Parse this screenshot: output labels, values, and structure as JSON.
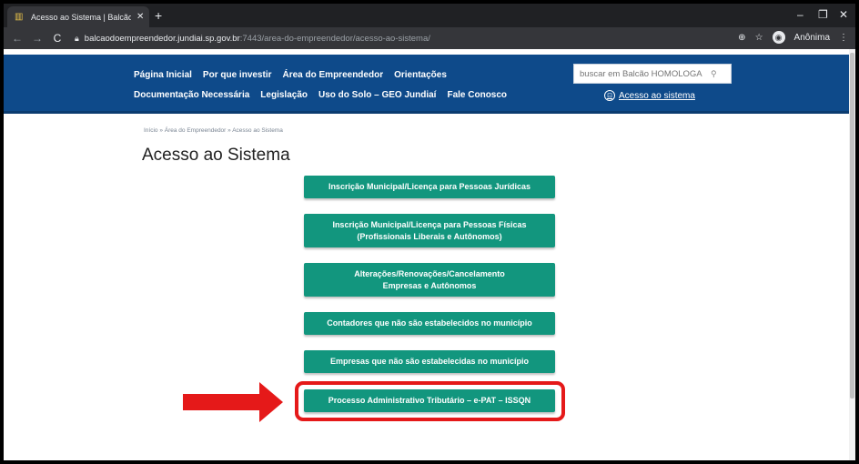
{
  "browser": {
    "tab_title": "Acesso ao Sistema | Balcão HOM",
    "tab_close": "✕",
    "new_tab": "+",
    "url_main": "balcaodoempreendedor.jundiai.sp.gov.br",
    "url_rest": ":7443/area-do-empreendedor/acesso-ao-sistema/",
    "profile_label": "Anônima",
    "icons": [
      "back-icon",
      "forward-icon",
      "reload-icon",
      "lock-icon",
      "zoom-icon",
      "star-icon",
      "incognito-icon",
      "menu-icon",
      "minimize-icon",
      "maximize-icon",
      "close-icon"
    ]
  },
  "header": {
    "nav_row1": [
      "Página Inicial",
      "Por que investir",
      "Área do Empreendedor",
      "Orientações"
    ],
    "nav_row2": [
      "Documentação Necessária",
      "Legislação",
      "Uso do Solo – GEO Jundiaí",
      "Fale Conosco"
    ],
    "search_placeholder": "buscar em Balcão HOMOLOGA",
    "access_link": "Acesso ao sistema"
  },
  "breadcrumb": "Início » Área do Empreendedor » Acesso ao Sistema",
  "page_title": "Acesso ao Sistema",
  "buttons": [
    {
      "line1": "Inscrição Municipal/Licença para Pessoas Jurídicas",
      "line2": ""
    },
    {
      "line1": "Inscrição Municipal/Licença para Pessoas Físicas",
      "line2": "(Profissionais Liberais e Autônomos)"
    },
    {
      "line1": "Alterações/Renovações/Cancelamento",
      "line2": "Empresas e Autônomos"
    },
    {
      "line1": "Contadores que não são estabelecidos no município",
      "line2": ""
    },
    {
      "line1": "Empresas que não são estabelecidas no município",
      "line2": ""
    },
    {
      "line1": "Processo Administrativo Tributário – e-PAT – ISSQN",
      "line2": ""
    }
  ],
  "colors": {
    "header_blue": "#0e4a8a",
    "button_teal": "#12967e",
    "highlight_red": "#e51919"
  }
}
